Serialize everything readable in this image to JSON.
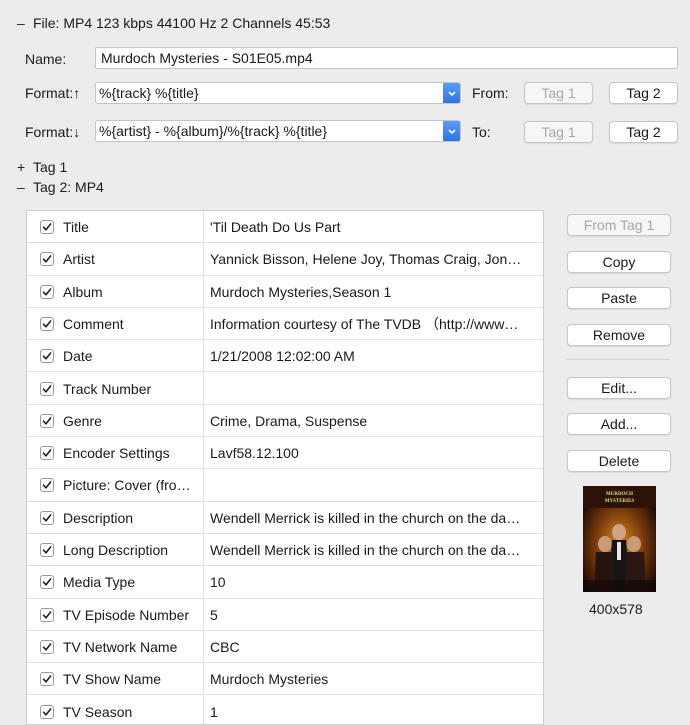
{
  "file_header": {
    "toggle": "–",
    "text": "File: MP4 123 kbps 44100 Hz 2 Channels 45:53"
  },
  "name": {
    "label": "Name:",
    "value": "Murdoch Mysteries - S01E05.mp4"
  },
  "format_up": {
    "label": "Format:↑",
    "value": "%{track} %{title}",
    "from_label": "From:",
    "tag1": "Tag 1",
    "tag2": "Tag 2"
  },
  "format_down": {
    "label": "Format:↓",
    "value": "%{artist} - %{album}/%{track} %{title}",
    "to_label": "To:",
    "tag1": "Tag 1",
    "tag2": "Tag 2"
  },
  "tag1_section": {
    "toggle": "+",
    "label": "Tag 1"
  },
  "tag2_section": {
    "toggle": "–",
    "label": "Tag 2: MP4"
  },
  "frames": [
    {
      "name": "Title",
      "value": "'Til Death Do Us Part"
    },
    {
      "name": "Artist",
      "value": "Yannick Bisson, Helene Joy, Thomas Craig, Jon…"
    },
    {
      "name": "Album",
      "value": "Murdoch Mysteries,Season 1"
    },
    {
      "name": "Comment",
      "value": "Information courtesy of The TVDB （http://www…"
    },
    {
      "name": "Date",
      "value": "1/21/2008 12:02:00 AM"
    },
    {
      "name": "Track Number",
      "value": ""
    },
    {
      "name": "Genre",
      "value": "Crime, Drama, Suspense"
    },
    {
      "name": "Encoder Settings",
      "value": "Lavf58.12.100"
    },
    {
      "name": "Picture: Cover (fro…",
      "value": ""
    },
    {
      "name": "Description",
      "value": "Wendell Merrick is killed in the church on the da…"
    },
    {
      "name": "Long Description",
      "value": "Wendell Merrick is killed in the church on the da…"
    },
    {
      "name": "Media Type",
      "value": "10"
    },
    {
      "name": "TV Episode Number",
      "value": "5"
    },
    {
      "name": "TV Network Name",
      "value": "CBC"
    },
    {
      "name": "TV Show Name",
      "value": "Murdoch Mysteries"
    },
    {
      "name": "TV Season",
      "value": "1"
    }
  ],
  "side_buttons": {
    "from_tag1": "From Tag 1",
    "copy": "Copy",
    "paste": "Paste",
    "remove": "Remove",
    "edit": "Edit...",
    "add": "Add...",
    "delete": "Delete"
  },
  "cover": {
    "title_text": "MURDOCH MYSTERIES",
    "size_label": "400x578"
  },
  "colors": {
    "accent": "#2a72e8",
    "background": "#ececec"
  },
  "icons": {
    "checkbox": "checkmark-icon",
    "combo": "chevron-updown-icon"
  }
}
